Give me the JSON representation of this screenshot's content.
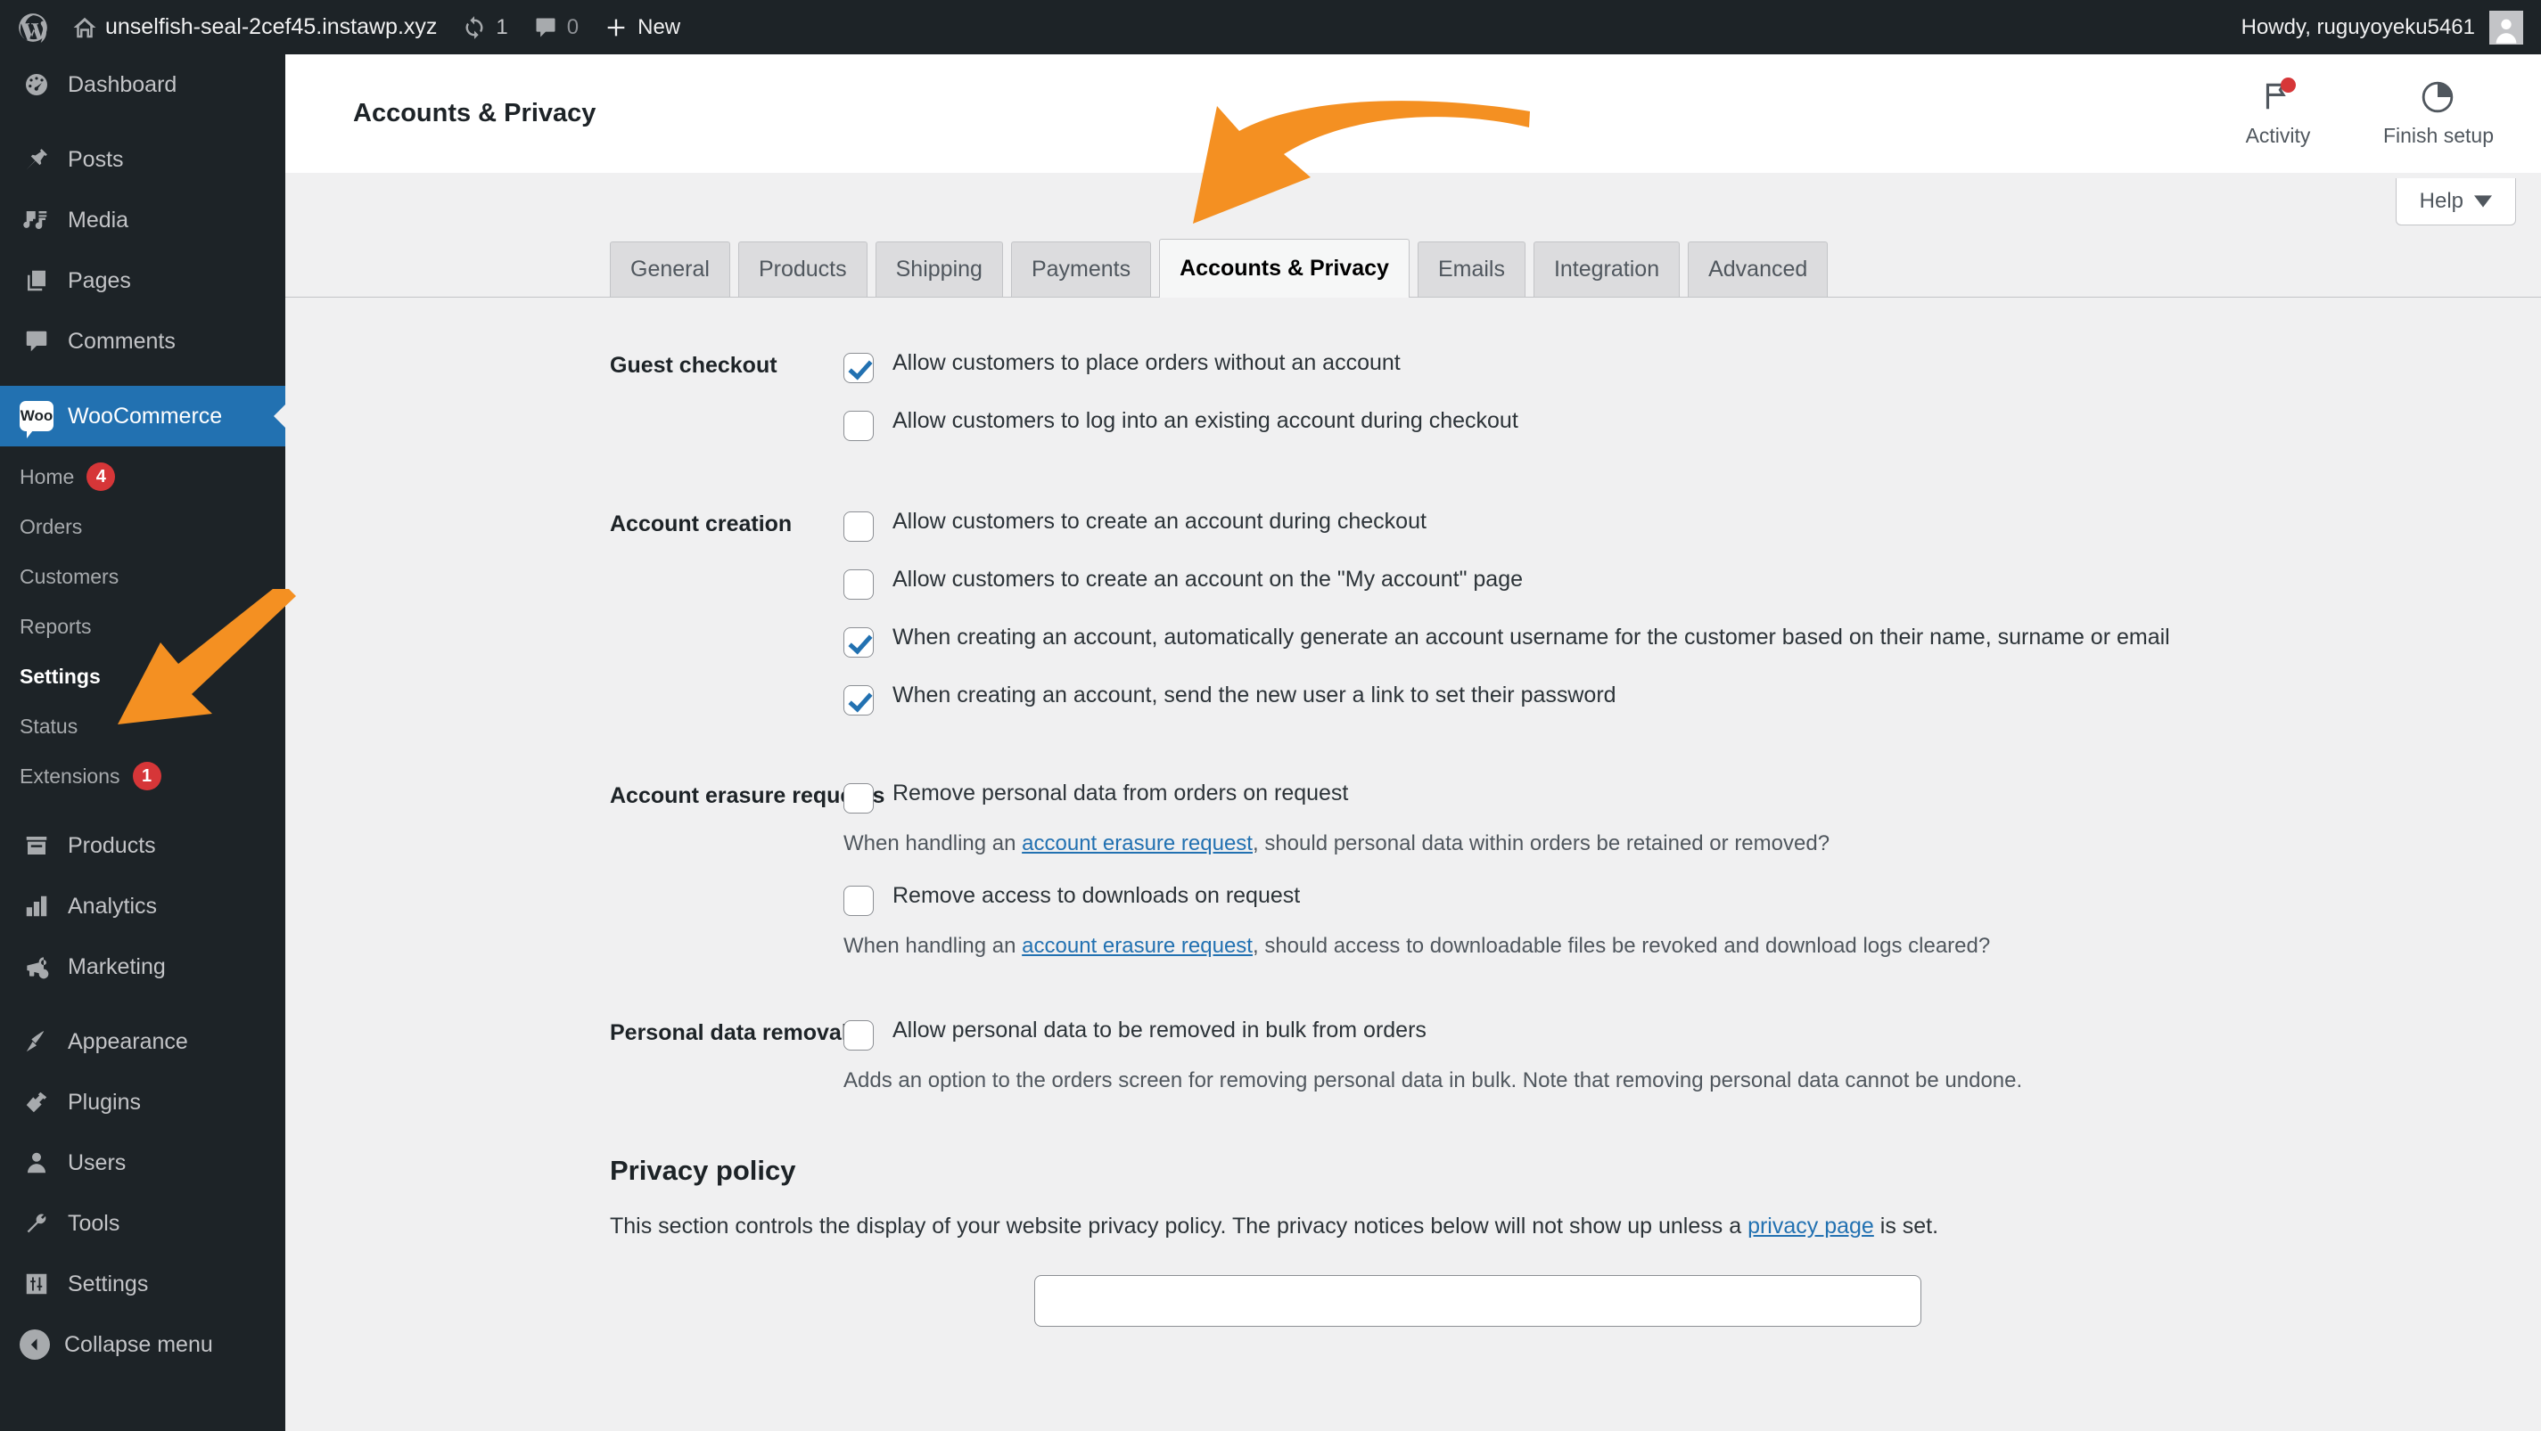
{
  "adminbar": {
    "site_name": "unselfish-seal-2cef45.instawp.xyz",
    "updates_count": "1",
    "comments_count": "0",
    "new_label": "New",
    "howdy": "Howdy, ruguyoyeku5461"
  },
  "sidebar": {
    "items": [
      {
        "label": "Dashboard",
        "icon": "dashboard-icon",
        "current": false
      },
      {
        "label": "Posts",
        "icon": "pin-icon",
        "current": false
      },
      {
        "label": "Media",
        "icon": "media-icon",
        "current": false
      },
      {
        "label": "Pages",
        "icon": "pages-icon",
        "current": false
      },
      {
        "label": "Comments",
        "icon": "comments-icon",
        "current": false
      },
      {
        "label": "WooCommerce",
        "icon": "woo-icon",
        "current": true
      },
      {
        "label": "Products",
        "icon": "products-icon",
        "current": false
      },
      {
        "label": "Analytics",
        "icon": "analytics-icon",
        "current": false
      },
      {
        "label": "Marketing",
        "icon": "megaphone-icon",
        "current": false
      },
      {
        "label": "Appearance",
        "icon": "brush-icon",
        "current": false
      },
      {
        "label": "Plugins",
        "icon": "plug-icon",
        "current": false
      },
      {
        "label": "Users",
        "icon": "user-icon",
        "current": false
      },
      {
        "label": "Tools",
        "icon": "wrench-icon",
        "current": false
      },
      {
        "label": "Settings",
        "icon": "settings-icon",
        "current": false
      }
    ],
    "woo_submenu": [
      {
        "label": "Home",
        "badge": "4",
        "current": false
      },
      {
        "label": "Orders",
        "badge": "",
        "current": false
      },
      {
        "label": "Customers",
        "badge": "",
        "current": false
      },
      {
        "label": "Reports",
        "badge": "",
        "current": false
      },
      {
        "label": "Settings",
        "badge": "",
        "current": true
      },
      {
        "label": "Status",
        "badge": "",
        "current": false
      },
      {
        "label": "Extensions",
        "badge": "1",
        "current": false
      }
    ],
    "collapse_label": "Collapse menu"
  },
  "header": {
    "page_title": "Accounts & Privacy",
    "activity_label": "Activity",
    "finish_setup_label": "Finish setup",
    "help_label": "Help"
  },
  "tabs": [
    {
      "label": "General",
      "active": false
    },
    {
      "label": "Products",
      "active": false
    },
    {
      "label": "Shipping",
      "active": false
    },
    {
      "label": "Payments",
      "active": false
    },
    {
      "label": "Accounts & Privacy",
      "active": true
    },
    {
      "label": "Emails",
      "active": false
    },
    {
      "label": "Integration",
      "active": false
    },
    {
      "label": "Advanced",
      "active": false
    }
  ],
  "settings": {
    "guest_checkout": {
      "label": "Guest checkout",
      "opt1": "Allow customers to place orders without an account",
      "opt1_checked": true,
      "opt2": "Allow customers to log into an existing account during checkout",
      "opt2_checked": false
    },
    "account_creation": {
      "label": "Account creation",
      "opt1": "Allow customers to create an account during checkout",
      "opt1_checked": false,
      "opt2": "Allow customers to create an account on the \"My account\" page",
      "opt2_checked": false,
      "opt3": "When creating an account, automatically generate an account username for the customer based on their name, surname or email",
      "opt3_checked": true,
      "opt4": "When creating an account, send the new user a link to set their password",
      "opt4_checked": true
    },
    "account_erasure": {
      "label": "Account erasure requests",
      "opt1": "Remove personal data from orders on request",
      "opt1_checked": false,
      "desc1_pre": "When handling an ",
      "desc1_link": "account erasure request",
      "desc1_post": ", should personal data within orders be retained or removed?",
      "opt2": "Remove access to downloads on request",
      "opt2_checked": false,
      "desc2_pre": "When handling an ",
      "desc2_link": "account erasure request",
      "desc2_post": ", should access to downloadable files be revoked and download logs cleared?"
    },
    "personal_data_removal": {
      "label": "Personal data removal",
      "opt1": "Allow personal data to be removed in bulk from orders",
      "opt1_checked": false,
      "desc": "Adds an option to the orders screen for removing personal data in bulk. Note that removing personal data cannot be undone."
    },
    "privacy_policy": {
      "heading": "Privacy policy",
      "desc_pre": "This section controls the display of your website privacy policy. The privacy notices below will not show up unless a ",
      "desc_link": "privacy page",
      "desc_post": " is set."
    }
  },
  "annotations": {
    "arrow_color": "#f49022",
    "tab_arrow_target": "Accounts & Privacy",
    "menu_arrow_target": "Settings"
  }
}
